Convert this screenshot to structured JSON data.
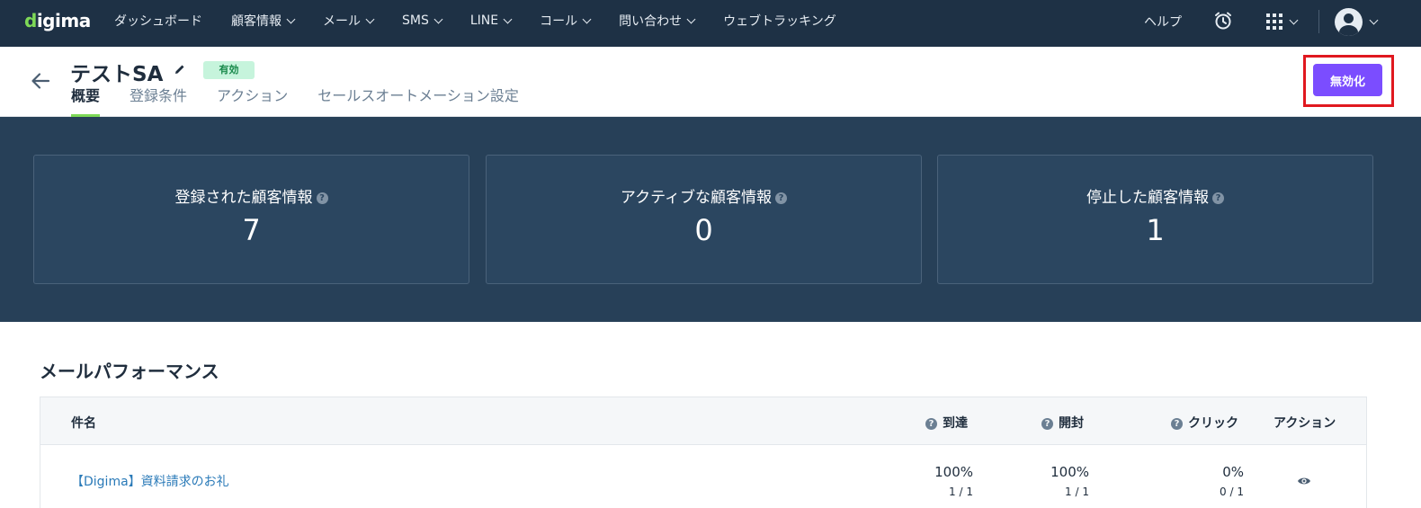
{
  "topnav": {
    "logo": "digima",
    "items": [
      {
        "label": "ダッシュボード",
        "has_menu": false
      },
      {
        "label": "顧客情報",
        "has_menu": true
      },
      {
        "label": "メール",
        "has_menu": true
      },
      {
        "label": "SMS",
        "has_menu": true
      },
      {
        "label": "LINE",
        "has_menu": true
      },
      {
        "label": "コール",
        "has_menu": true
      },
      {
        "label": "問い合わせ",
        "has_menu": true
      },
      {
        "label": "ウェブトラッキング",
        "has_menu": false
      }
    ],
    "help_label": "ヘルプ"
  },
  "header": {
    "title": "テストSA",
    "status_badge": "有効",
    "tabs": [
      "概要",
      "登録条件",
      "アクション",
      "セールスオートメーション設定"
    ],
    "active_tab": "概要",
    "deactivate_label": "無効化"
  },
  "stats": [
    {
      "label": "登録された顧客情報",
      "value": "7"
    },
    {
      "label": "アクティブな顧客情報",
      "value": "0"
    },
    {
      "label": "停止した顧客情報",
      "value": "1"
    }
  ],
  "mail_performance": {
    "title": "メールパフォーマンス",
    "columns": {
      "subject": "件名",
      "delivered": "到達",
      "opened": "開封",
      "clicked": "クリック",
      "action": "アクション"
    },
    "rows": [
      {
        "subject": "【Digima】資料請求のお礼",
        "delivered_pct": "100%",
        "delivered_ratio": "1 / 1",
        "opened_pct": "100%",
        "opened_ratio": "1 / 1",
        "clicked_pct": "0%",
        "clicked_ratio": "0 / 1"
      }
    ]
  },
  "colors": {
    "nav_bg": "#1e3145",
    "stats_bg": "#274058",
    "accent_green": "#7ed957",
    "button_purple": "#7b4dff",
    "highlight_red": "#e0181f",
    "link_blue": "#2a7ab8"
  }
}
